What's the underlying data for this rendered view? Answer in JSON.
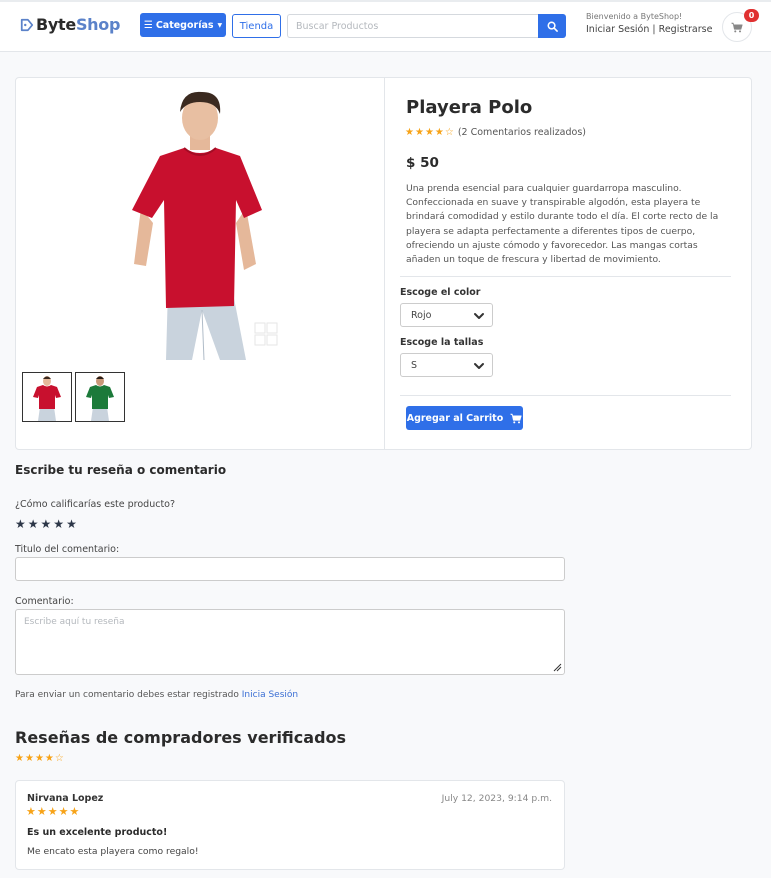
{
  "header": {
    "logo_prefix": "Byte",
    "logo_suffix": "Shop",
    "categories_label": "Categorías",
    "store_label": "Tienda",
    "search_placeholder": "Buscar Productos",
    "welcome": "Bienvenido a ByteShop!",
    "login": "Iniciar Sesión",
    "separator": "|",
    "register": "Registrarse",
    "cart_count": "0",
    "icons": [
      "tag-icon",
      "menu-icon",
      "caret-down-icon",
      "search-icon",
      "cart-icon"
    ]
  },
  "product": {
    "title": "Playera Polo",
    "rating": 4,
    "rating_max": 5,
    "reviews_text": "(2 Comentarios realizados)",
    "price": "$ 50",
    "description": "Una prenda esencial para cualquier guardarropa masculino. Confeccionada en suave y transpirable algodón, esta playera te brindará comodidad y estilo durante todo el día. El corte recto de la playera se adapta perfectamente a diferentes tipos de cuerpo, ofreciendo un ajuste cómodo y favorecedor. Las mangas cortas añaden un toque de frescura y libertad de movimiento.",
    "color_label": "Escoge el color",
    "color_value": "Rojo",
    "size_label": "Escoge la tallas",
    "size_value": "S",
    "add_to_cart": "Agregar al Carrito",
    "image_colors": [
      "#c8102e",
      "#1c7a3a"
    ]
  },
  "review_form": {
    "title": "Escribe tu reseña o comentario",
    "question": "¿Cómo calificarías este producto?",
    "stars": 5,
    "title_label": "Titulo del comentario:",
    "comment_label": "Comentario:",
    "comment_placeholder": "Escribe aquí tu reseña",
    "note": "Para enviar un comentario debes estar registrado",
    "note_link": "Inicia Sesión"
  },
  "reviews": {
    "title": "Reseñas de compradores verificados",
    "average": 4,
    "items": [
      {
        "name": "Nirvana Lopez",
        "date": "July 12, 2023, 9:14 p.m.",
        "rating": 5,
        "heading": "Es un excelente producto!",
        "body": "Me encato esta playera como regalo!"
      }
    ]
  },
  "colors": {
    "primary": "#2f6fe8",
    "star": "#f7a318",
    "badge": "#e03131"
  }
}
